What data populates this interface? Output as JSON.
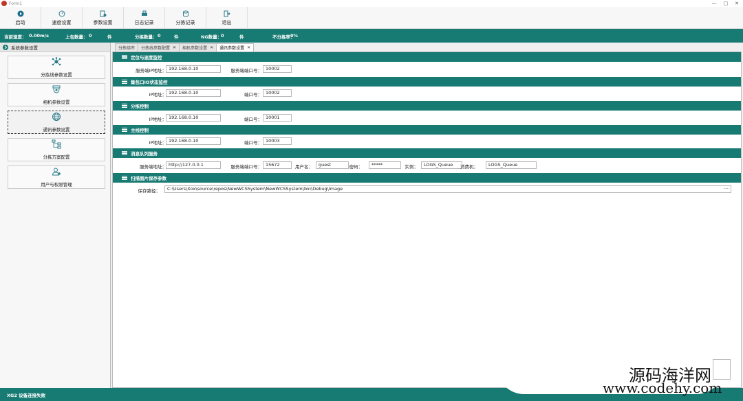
{
  "window": {
    "title": "Form1",
    "controls": [
      "—",
      "□",
      "✕"
    ]
  },
  "toolbar": {
    "buttons": [
      {
        "label": "启动",
        "icon": "play-icon"
      },
      {
        "label": "速度设置",
        "icon": "speedometer-icon"
      },
      {
        "label": "参数设置",
        "icon": "settings-icon"
      },
      {
        "label": "日志记录",
        "icon": "printer-icon"
      },
      {
        "label": "分拣记录",
        "icon": "database-icon"
      },
      {
        "label": "退出",
        "icon": "exit-icon"
      }
    ]
  },
  "status": {
    "speed_label": "当前速度：",
    "speed_value": "0.00",
    "speed_unit": "m/s",
    "upload_label": "上包数量：",
    "upload_value": "0",
    "unit_piece": "件",
    "sort_label": "分拣数量：",
    "sort_value": "0",
    "ng_label": "NG数量：",
    "ng_value": "0",
    "nonsort_label": "不分拣率：",
    "nonsort_value": "0%"
  },
  "sidebar": {
    "header": "系统参数设置",
    "items": [
      {
        "label": "分拣线参数设置",
        "icon": "network-hub-icon"
      },
      {
        "label": "相机参数设置",
        "icon": "camera-icon"
      },
      {
        "label": "通讯参数设置",
        "icon": "globe-icon"
      },
      {
        "label": "分拣方案配置",
        "icon": "flowchart-icon"
      },
      {
        "label": "用户与权限管理",
        "icon": "users-icon"
      }
    ]
  },
  "tabs": [
    {
      "label": "分拣结市",
      "closable": false
    },
    {
      "label": "分拣线参数配置",
      "closable": true
    },
    {
      "label": "相机参数设置",
      "closable": true
    },
    {
      "label": "通讯参数设置",
      "closable": true
    }
  ],
  "sections": {
    "speed": {
      "title": "定位与速度监控",
      "ip_label": "服务端IP地址：",
      "ip_value": "192.168.0.10",
      "port_label": "服务端端口号：",
      "port_value": "10002"
    },
    "io": {
      "title": "集包口IO状态监控",
      "ip_label": "IP地址：",
      "ip_value": "192.168.0.10",
      "port_label": "端口号：",
      "port_value": "10002"
    },
    "sort": {
      "title": "分拣控制",
      "ip_label": "IP地址：",
      "ip_value": "192.168.0.10",
      "port_label": "端口号：",
      "port_value": "10001"
    },
    "main": {
      "title": "主线控制",
      "ip_label": "IP地址：",
      "ip_value": "192.168.0.10",
      "port_label": "端口号：",
      "port_value": "10003"
    },
    "mq": {
      "title": "消息队列服务",
      "addr_label": "服务端地址：",
      "addr_value": "http://127.0.0.1",
      "port_label": "服务端端口号：",
      "port_value": "15672",
      "user_label": "用户名：",
      "user_value": "guest",
      "pwd_label": "密码：",
      "pwd_value": "*****",
      "inst_label": "实例：",
      "inst_value": "LOGS_Queue",
      "consumer_label": "消费机：",
      "consumer_value": "LOGS_Queue"
    },
    "image": {
      "title": "扫描图片保存参数",
      "path_label": "保存路径：",
      "path_value": "C:\\Users\\Xox\\source\\repos\\NewWCSSystem\\NewWCSSystem\\bin\\Debug\\Image",
      "browse_label": "···"
    }
  },
  "footer": {
    "text": "XG2 设备连接失败"
  },
  "watermark": {
    "line1": "源码海洋网",
    "line2": "www.codehy.com"
  },
  "colors": {
    "accent": "#177a73"
  }
}
